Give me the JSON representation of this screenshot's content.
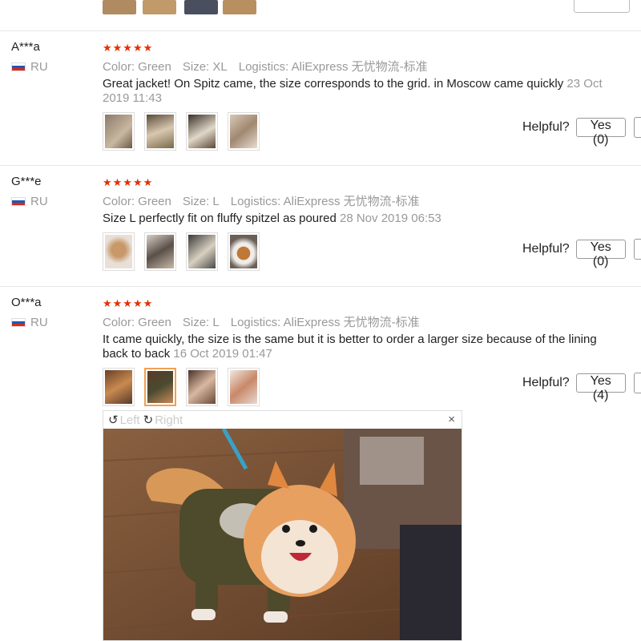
{
  "reviews": [
    {
      "user": "A***a",
      "country": "RU",
      "stars": "★★★★★",
      "color": "Color: Green",
      "size": "Size: XL",
      "logistics": "Logistics: AliExpress 无忧物流-标准",
      "text": "Great jacket! On Spitz came, the size corresponds to the grid. in Moscow came quickly",
      "date": "23 Oct 2019 11:43",
      "helpful_label": "Helpful?",
      "yes_label": "Yes (0)"
    },
    {
      "user": "G***e",
      "country": "RU",
      "stars": "★★★★★",
      "color": "Color: Green",
      "size": "Size: L",
      "logistics": "Logistics: AliExpress 无忧物流-标准",
      "text": "Size L perfectly fit on fluffy spitzel as poured",
      "date": "28 Nov 2019 06:53",
      "helpful_label": "Helpful?",
      "yes_label": "Yes (0)"
    },
    {
      "user": "O***a",
      "country": "RU",
      "stars": "★★★★★",
      "color": "Color: Green",
      "size": "Size: L",
      "logistics": "Logistics: AliExpress 无忧物流-标准",
      "text": "It came quickly, the size is the same but it is better to order a larger size because of the lining back to back",
      "date": "16 Oct 2019 01:47",
      "helpful_label": "Helpful?",
      "yes_label": "Yes (4)"
    }
  ],
  "viewer": {
    "rotate_left_label": "Left",
    "rotate_right_label": "Right",
    "close_label": "×"
  },
  "icons": {
    "rotate_left": "rotate-left-icon",
    "rotate_right": "rotate-right-icon",
    "close": "close-icon"
  }
}
